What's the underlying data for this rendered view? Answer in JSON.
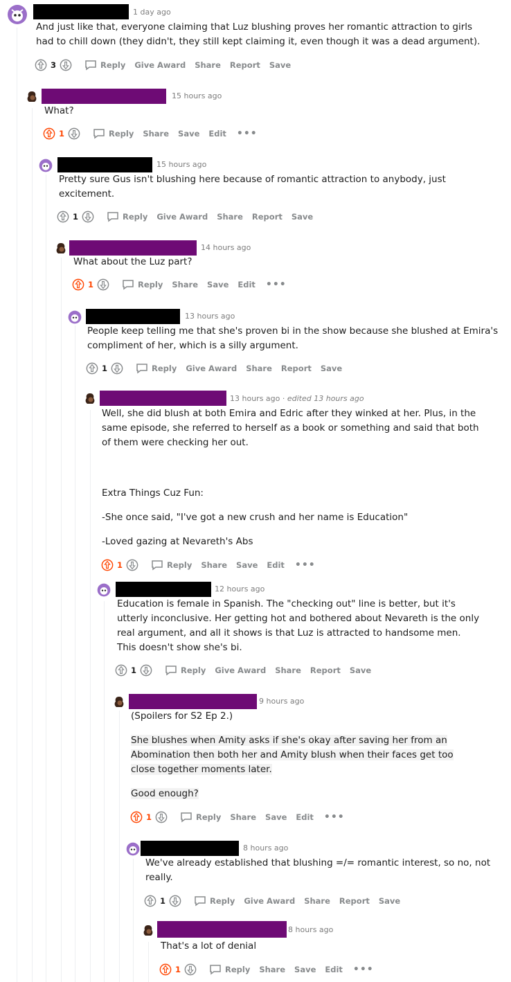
{
  "colors": {
    "redact_black": "#000000",
    "redact_purple": "#6e0b75",
    "upvote_orange": "#ff4500",
    "meta_gray": "#7c7c7c",
    "action_gray": "#878a8c",
    "thread_line": "#edeff1"
  },
  "labels": {
    "reply": "Reply",
    "give_award": "Give Award",
    "share": "Share",
    "report": "Report",
    "save": "Save",
    "edit": "Edit",
    "more": "•••"
  },
  "comments": [
    {
      "time": "1 day ago",
      "score": "3",
      "upvoted": false,
      "paragraphs": [
        "And just like that, everyone claiming that Luz blushing proves her romantic attraction to girls had to chill down (they didn't, they still kept claiming it, even though it was a dead argument)."
      ]
    },
    {
      "time": "15 hours ago",
      "score": "1",
      "upvoted": true,
      "paragraphs": [
        "What?"
      ]
    },
    {
      "time": "15 hours ago",
      "score": "1",
      "upvoted": false,
      "paragraphs": [
        "Pretty sure Gus isn't blushing here because of romantic attraction to anybody, just excitement."
      ]
    },
    {
      "time": "14 hours ago",
      "score": "1",
      "upvoted": true,
      "paragraphs": [
        "What about the Luz part?"
      ]
    },
    {
      "time": "13 hours ago",
      "score": "1",
      "upvoted": false,
      "paragraphs": [
        "People keep telling me that she's proven bi in the show because she blushed at Emira's compliment of her, which is a silly argument."
      ]
    },
    {
      "time": "13 hours ago",
      "edited": "edited 13 hours ago",
      "score": "1",
      "upvoted": true,
      "paragraphs": [
        "Well, she did blush at both Emira and Edric after they winked at her. Plus, in the same episode, she referred to herself as a book or something and said that both of them were checking her out.",
        "Extra Things Cuz Fun:",
        "-She once said, \"I've got a new crush and her name is Education\"",
        "-Loved gazing at Nevareth's Abs"
      ]
    },
    {
      "time": "12 hours ago",
      "score": "1",
      "upvoted": false,
      "paragraphs": [
        "Education is female in Spanish. The \"checking out\" line is better, but it's utterly inconclusive. Her getting hot and bothered about Nevareth is the only real argument, and all it shows is that Luz is attracted to handsome men. This doesn't show she's bi."
      ]
    },
    {
      "time": "9 hours ago",
      "score": "1",
      "upvoted": true,
      "paragraphs": [
        "(Spoilers for S2 Ep 2.)",
        "She blushes when Amity asks if she's okay after saving her from an Abomination then both her and Amity blush when their faces get too close together moments later.",
        "Good enough?"
      ]
    },
    {
      "time": "8 hours ago",
      "score": "1",
      "upvoted": false,
      "paragraphs": [
        "We've already established that blushing =/= romantic interest, so no, not really."
      ]
    },
    {
      "time": "8 hours ago",
      "score": "1",
      "upvoted": true,
      "paragraphs": [
        "That's a lot of denial"
      ]
    }
  ]
}
